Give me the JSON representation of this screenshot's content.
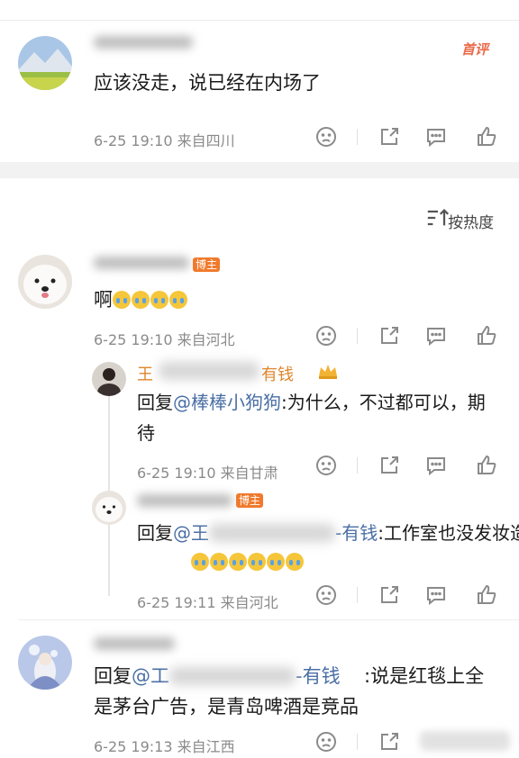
{
  "comments": {
    "top": {
      "first_badge": "首评",
      "text": "应该没走，说已经在内场了",
      "meta": "6-25 19:10 来自四川"
    },
    "sort": {
      "label": "按热度"
    },
    "c1": {
      "badge": "博主",
      "text": "啊",
      "meta": "6-25 19:10 来自河北"
    },
    "r1": {
      "name_prefix": "王",
      "name_suffix": "有钱",
      "reply_prefix": "回复",
      "mention": "@棒棒小狗狗",
      "text": ":为什么，不过都可以，期待",
      "meta": "6-25 19:10 来自甘肃"
    },
    "r2": {
      "badge": "博主",
      "reply_prefix": "回复",
      "mention_start": "@王",
      "mention_end": "-有钱",
      "text": ":工作室也没发妆造",
      "meta": "6-25 19:11 来自河北"
    },
    "c2": {
      "reply_prefix": "回复",
      "mention_start": "@工",
      "mention_end": "-有钱",
      "text": ":说是红毯上全是茅台广告，是青岛啤酒是竞品",
      "meta": "6-25 19:13 来自江西"
    }
  },
  "colors": {
    "accent_orange": "#f07a2c",
    "mention_blue": "#4a6fa5",
    "meta_gray": "#8a8a8a"
  }
}
